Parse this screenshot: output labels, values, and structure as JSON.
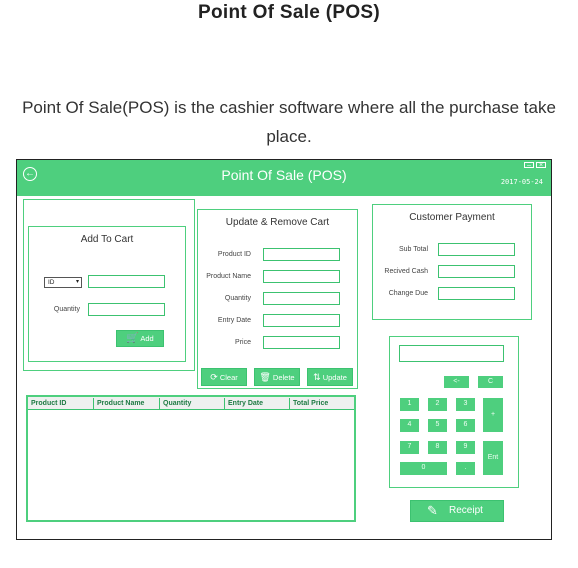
{
  "page": {
    "heading": "Point Of Sale (POS)",
    "description": "Point Of Sale(POS) is the cashier software where all the purchase take place."
  },
  "app": {
    "title": "Point Of Sale (POS)",
    "date": "2017-05-24",
    "colors": {
      "accent": "#4ecf7e",
      "border": "#3cc270",
      "background": "#d8d8d8"
    }
  },
  "add_to_cart": {
    "title": "Add To Cart",
    "select_value": "ID",
    "quantity_label": "Quantity",
    "add_label": "Add"
  },
  "update_cart": {
    "title": "Update & Remove Cart",
    "fields": [
      "Product ID",
      "Product Name",
      "Quantity",
      "Entry Date",
      "Price"
    ],
    "clear_label": "Clear",
    "delete_label": "Delete",
    "update_label": "Update"
  },
  "payment": {
    "title": "Customer Payment",
    "fields": [
      "Sub Total",
      "Recived Cash",
      "Change Due"
    ]
  },
  "table": {
    "columns": [
      "Product ID",
      "Product Name",
      "Quantity",
      "Entry Date",
      "Total Price"
    ]
  },
  "keypad": {
    "backspace": "<-",
    "clear": "C",
    "plus": "+",
    "enter": "Ent",
    "digits": [
      "1",
      "2",
      "3",
      "4",
      "5",
      "6",
      "7",
      "8",
      "9",
      "0",
      "."
    ]
  },
  "receipt_label": "Receipt"
}
